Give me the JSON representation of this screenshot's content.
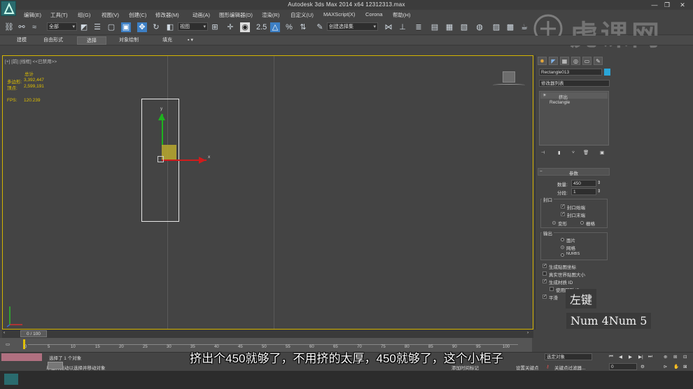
{
  "window": {
    "title": "Autodesk 3ds Max  2014 x64      12312313.max",
    "controls": [
      "—",
      "❐",
      "✕"
    ]
  },
  "menu": [
    "编辑(E)",
    "工具(T)",
    "组(G)",
    "视图(V)",
    "创建(C)",
    "修改器(M)",
    "动画(A)",
    "图形编辑器(D)",
    "渲染(R)",
    "自定义(U)",
    "MAXScript(X)",
    "Corona",
    "帮助(H)"
  ],
  "toolbar": {
    "selection_filter": "全部",
    "ref_coord": "视图",
    "named_selection": "创建选择集"
  },
  "ribbon": {
    "tabs": [
      "建模",
      "自由形式",
      "选择",
      "对象绘制",
      "填充"
    ],
    "active": "选择"
  },
  "viewport": {
    "label": "[+] [前] [线框]  <<已禁用>>",
    "stats": {
      "header": "总计",
      "polys_label": "多边形:",
      "polys_value": "3,392,447",
      "verts_label": "顶点:",
      "verts_value": "2,599,191",
      "fps_label": "FPS:",
      "fps_value": "120.239"
    },
    "gizmo": {
      "y_label": "y",
      "x_label": "x"
    }
  },
  "command_panel": {
    "object_name": "Rectangle013",
    "modifier_list": "修改器列表",
    "stack": [
      {
        "label": "挤出",
        "selected": true
      },
      {
        "label": "Rectangle",
        "selected": false
      }
    ],
    "rollout_title": "参数",
    "amount_label": "数量:",
    "amount_value": "450",
    "segments_label": "分段:",
    "segments_value": "1",
    "capping": {
      "title": "封口",
      "cap_start": "封口始端",
      "cap_end": "封口末端",
      "morph": "变形",
      "grid": "栅格"
    },
    "output": {
      "title": "输出",
      "patch": "面片",
      "mesh": "网格",
      "nurbs": "NURBS"
    },
    "options": [
      {
        "label": "生成贴图坐标",
        "checked": true
      },
      {
        "label": "真实世界贴图大小",
        "checked": false
      },
      {
        "label": "生成材质 ID",
        "checked": true
      },
      {
        "label": "使用图形 ID",
        "checked": false
      },
      {
        "label": "平滑",
        "checked": true
      }
    ]
  },
  "timeline": {
    "frame": "0 / 100",
    "ticks": [
      "0",
      "5",
      "10",
      "15",
      "20",
      "25",
      "30",
      "35",
      "40",
      "45",
      "50",
      "55",
      "60",
      "65",
      "70",
      "75",
      "80",
      "85",
      "90",
      "95",
      "100"
    ]
  },
  "status": {
    "selected": "选择了 1 个对象",
    "prompt": "单击并拖动以选择并移动对象",
    "set_key": "设置关键点",
    "key_filter": "关键点过滤器...",
    "selected_object": "选定对象",
    "add_tag": "添加时间标记",
    "frame_value": "0"
  },
  "overlays": {
    "subtitle": "挤出个450就够了，不用挤的太厚，450就够了，这个小柜子",
    "key_left": "左键",
    "key_num": "Num 4Num 5",
    "watermark": "虎课网"
  }
}
